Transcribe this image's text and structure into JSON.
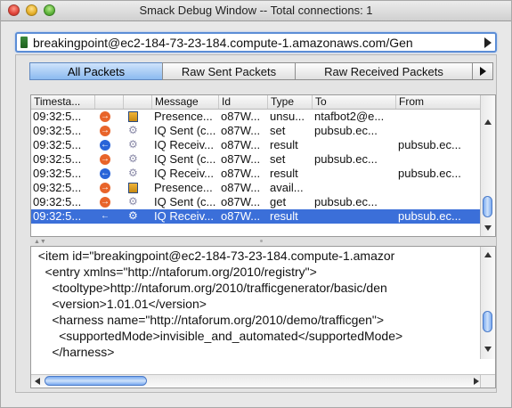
{
  "window": {
    "title": "Smack Debug Window -- Total connections: 1"
  },
  "connection": {
    "selected": "breakingpoint@ec2-184-73-23-184.compute-1.amazonaws.com/Gen"
  },
  "tabs": [
    {
      "label": "All Packets",
      "active": true
    },
    {
      "label": "Raw Sent Packets",
      "active": false
    },
    {
      "label": "Raw Received Packets",
      "active": false
    }
  ],
  "table": {
    "columns": [
      "Timesta...",
      "",
      "",
      "Message",
      "Id",
      "Type",
      "To",
      "From"
    ],
    "rows": [
      {
        "time": "09:32:5...",
        "dir": "out",
        "kind": "presence",
        "message": "Presence...",
        "id": "o87W...",
        "type": "unsu...",
        "to": "ntafbot2@e...",
        "from": ""
      },
      {
        "time": "09:32:5...",
        "dir": "out",
        "kind": "iq",
        "message": "IQ Sent (c...",
        "id": "o87W...",
        "type": "set",
        "to": "pubsub.ec...",
        "from": ""
      },
      {
        "time": "09:32:5...",
        "dir": "in",
        "kind": "iq",
        "message": "IQ Receiv...",
        "id": "o87W...",
        "type": "result",
        "to": "",
        "from": "pubsub.ec..."
      },
      {
        "time": "09:32:5...",
        "dir": "out",
        "kind": "iq",
        "message": "IQ Sent (c...",
        "id": "o87W...",
        "type": "set",
        "to": "pubsub.ec...",
        "from": ""
      },
      {
        "time": "09:32:5...",
        "dir": "in",
        "kind": "iq",
        "message": "IQ Receiv...",
        "id": "o87W...",
        "type": "result",
        "to": "",
        "from": "pubsub.ec..."
      },
      {
        "time": "09:32:5...",
        "dir": "out",
        "kind": "presence",
        "message": "Presence...",
        "id": "o87W...",
        "type": "avail...",
        "to": "",
        "from": ""
      },
      {
        "time": "09:32:5...",
        "dir": "out",
        "kind": "iq",
        "message": "IQ Sent (c...",
        "id": "o87W...",
        "type": "get",
        "to": "pubsub.ec...",
        "from": ""
      },
      {
        "time": "09:32:5...",
        "dir": "in",
        "kind": "iq",
        "message": "IQ Receiv...",
        "id": "o87W...",
        "type": "result",
        "to": "",
        "from": "pubsub.ec...",
        "selected": true
      }
    ]
  },
  "xml": {
    "lines": [
      "  <item id=\"breakingpoint@ec2-184-73-23-184.compute-1.amazor",
      "    <entry xmlns=\"http://ntaforum.org/2010/registry\">",
      "      <tooltype>http://ntaforum.org/2010/trafficgenerator/basic/den",
      "      <version>1.01.01</version>",
      "      <harness name=\"http://ntaforum.org/2010/demo/trafficgen\">",
      "        <supportedMode>invisible_and_automated</supportedMode>",
      "      </harness>"
    ]
  },
  "colors": {
    "selection": "#3b6fd9",
    "outgoing": "#e8642a",
    "incoming": "#2a64d8",
    "focus": "#5b8dd6"
  }
}
